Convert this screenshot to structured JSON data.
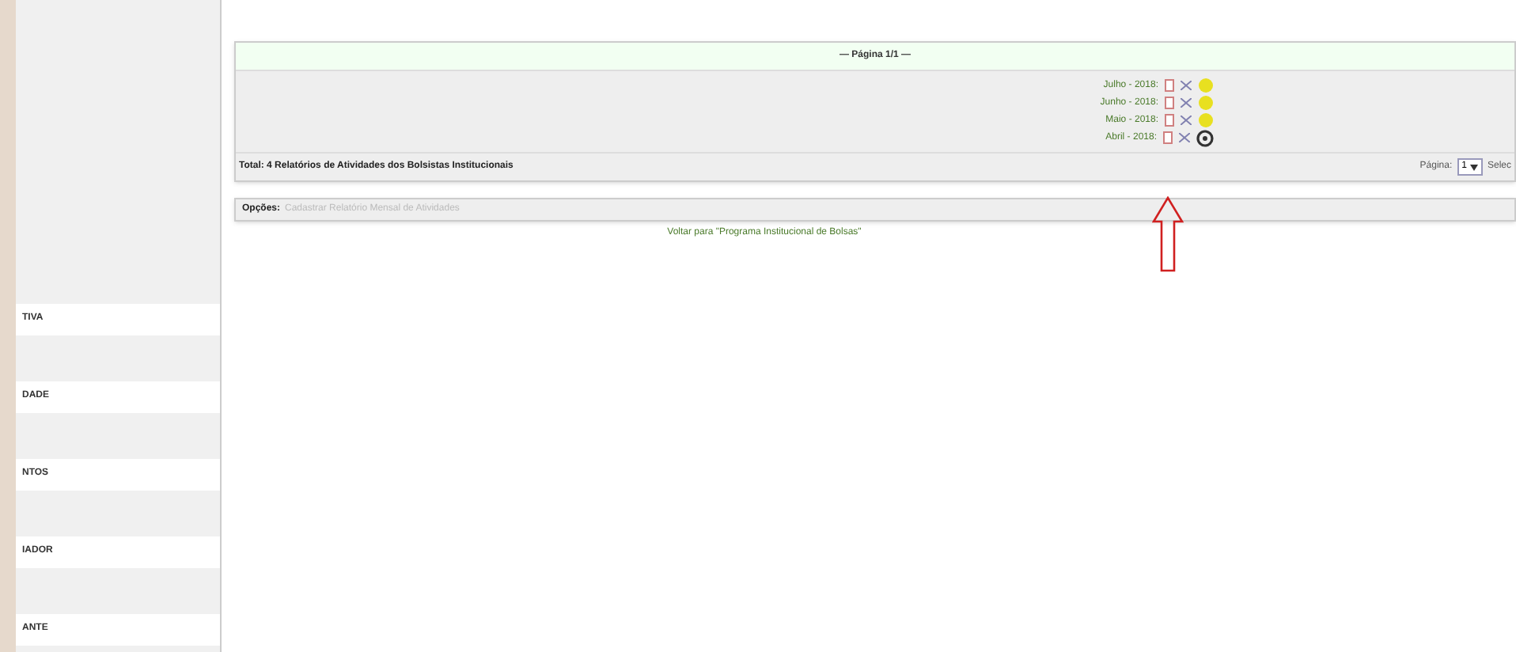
{
  "sidebar": {
    "items": [
      "TIVA",
      "DADE",
      "NTOS",
      "IADOR",
      "ANTE"
    ]
  },
  "report_panel": {
    "pager_title": "— Página 1/1 —",
    "rows": [
      {
        "label": "Julho - 2018:",
        "kind": "approved"
      },
      {
        "label": "Junho - 2018:",
        "kind": "approved"
      },
      {
        "label": "Maio - 2018:",
        "kind": "approved"
      },
      {
        "label": "Abril - 2018:",
        "kind": "pending"
      }
    ],
    "total": "Total: 4 Relatórios de Atividades dos Bolsistas Institucionais",
    "page_label": "Página:",
    "page_select": "1",
    "page_cut": "Selec"
  },
  "options": {
    "label": "Opções:",
    "link": "Cadastrar Relatório Mensal de Atividades"
  },
  "back_link": "Voltar para \"Programa Institucional de Bolsas\""
}
